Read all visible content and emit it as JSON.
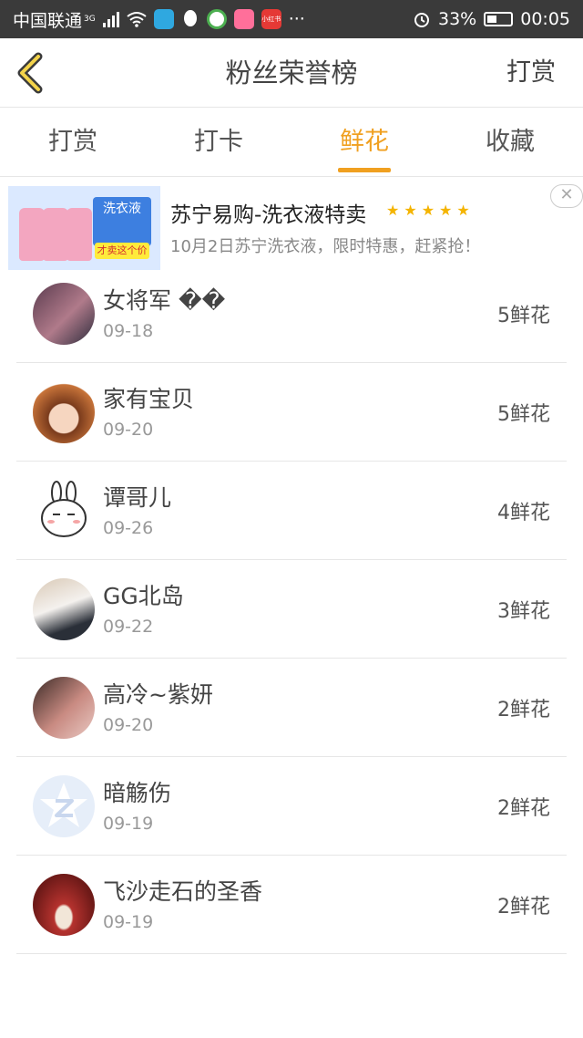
{
  "status_bar": {
    "carrier": "中国联通",
    "network": "3G",
    "battery": "33%",
    "time": "00:05",
    "more": "···",
    "app_badge": "小红书"
  },
  "header": {
    "title": "粉丝荣誉榜",
    "action": "打赏"
  },
  "tabs": [
    {
      "label": "打赏"
    },
    {
      "label": "打卡"
    },
    {
      "label": "鲜花"
    },
    {
      "label": "收藏"
    }
  ],
  "ad": {
    "title": "苏宁易购-洗衣液特卖",
    "stars": "★★★★★",
    "description": "10月2日苏宁洗衣液，限时特惠，赶紧抢！",
    "image_label": "洗衣液",
    "image_price": "才卖这个价",
    "close": "✕"
  },
  "fans": [
    {
      "name": "女将军 ��",
      "date": "09-18",
      "count": "5鲜花"
    },
    {
      "name": "家有宝贝",
      "date": "09-20",
      "count": "5鲜花"
    },
    {
      "name": "谭哥儿",
      "date": "09-26",
      "count": "4鲜花"
    },
    {
      "name": "GG北岛",
      "date": "09-22",
      "count": "3鲜花"
    },
    {
      "name": "高冷~紫妍",
      "date": "09-20",
      "count": "2鲜花"
    },
    {
      "name": "暗觞伤",
      "date": "09-19",
      "count": "2鲜花"
    },
    {
      "name": "飞沙走石的圣香",
      "date": "09-19",
      "count": "2鲜花"
    }
  ],
  "colors": {
    "accent": "#f0a020",
    "status_bar": "#3a3a3a"
  }
}
